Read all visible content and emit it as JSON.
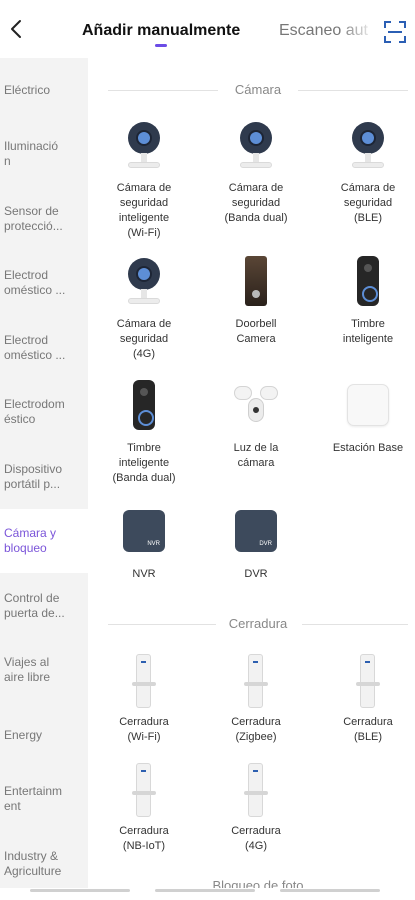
{
  "header": {
    "tab_manual": "Añadir manualmente",
    "tab_auto": "Escaneo aut",
    "back_icon": "back-arrow-icon",
    "scan_icon": "scan-qr-icon",
    "accent": "#6b4ce6"
  },
  "sidebar": {
    "items": [
      {
        "label": "Eléctrico"
      },
      {
        "label": "Iluminació\nn"
      },
      {
        "label": "Sensor de\nprotecció..."
      },
      {
        "label": "Electrod\noméstico ..."
      },
      {
        "label": "Electrod\noméstico ..."
      },
      {
        "label": "Electrodom\néstico"
      },
      {
        "label": "Dispositivo\nportátil p..."
      },
      {
        "label": "Cámara y\nbloqueo"
      },
      {
        "label": "Control de\npuerta de..."
      },
      {
        "label": "Viajes al\naire libre"
      },
      {
        "label": "Energy"
      },
      {
        "label": "Entertainm\nent"
      },
      {
        "label": "Industry &\nAgriculture"
      }
    ],
    "active_index": 7
  },
  "sections": {
    "camera": {
      "title": "Cámara",
      "devices": [
        {
          "label": "Cámara de\nseguridad\ninteligente\n(Wi-Fi)",
          "icon": "security-camera-icon"
        },
        {
          "label": "Cámara de\nseguridad\n(Banda dual)",
          "icon": "security-camera-icon"
        },
        {
          "label": "Cámara de\nseguridad\n(BLE)",
          "icon": "security-camera-icon"
        },
        {
          "label": "Cámara de\nseguridad\n(4G)",
          "icon": "security-camera-icon"
        },
        {
          "label": "Doorbell\nCamera",
          "icon": "doorbell-camera-icon"
        },
        {
          "label": "Timbre\ninteligente",
          "icon": "smart-doorbell-icon"
        },
        {
          "label": "Timbre\ninteligente\n(Banda dual)",
          "icon": "smart-doorbell-icon"
        },
        {
          "label": "Luz de la\ncámara",
          "icon": "floodlight-camera-icon"
        },
        {
          "label": "Estación Base",
          "icon": "base-station-icon"
        },
        {
          "label": "NVR",
          "icon": "nvr-icon",
          "badge": "NVR"
        },
        {
          "label": "DVR",
          "icon": "dvr-icon",
          "badge": "DVR"
        }
      ]
    },
    "lock": {
      "title": "Cerradura",
      "devices": [
        {
          "label": "Cerradura\n(Wi-Fi)",
          "icon": "door-lock-icon"
        },
        {
          "label": "Cerradura\n(Zigbee)",
          "icon": "door-lock-icon"
        },
        {
          "label": "Cerradura\n(BLE)",
          "icon": "door-lock-icon"
        },
        {
          "label": "Cerradura\n(NB-IoT)",
          "icon": "door-lock-icon"
        },
        {
          "label": "Cerradura\n(4G)",
          "icon": "door-lock-icon"
        }
      ]
    },
    "next_title": "Bloqueo de foto"
  }
}
